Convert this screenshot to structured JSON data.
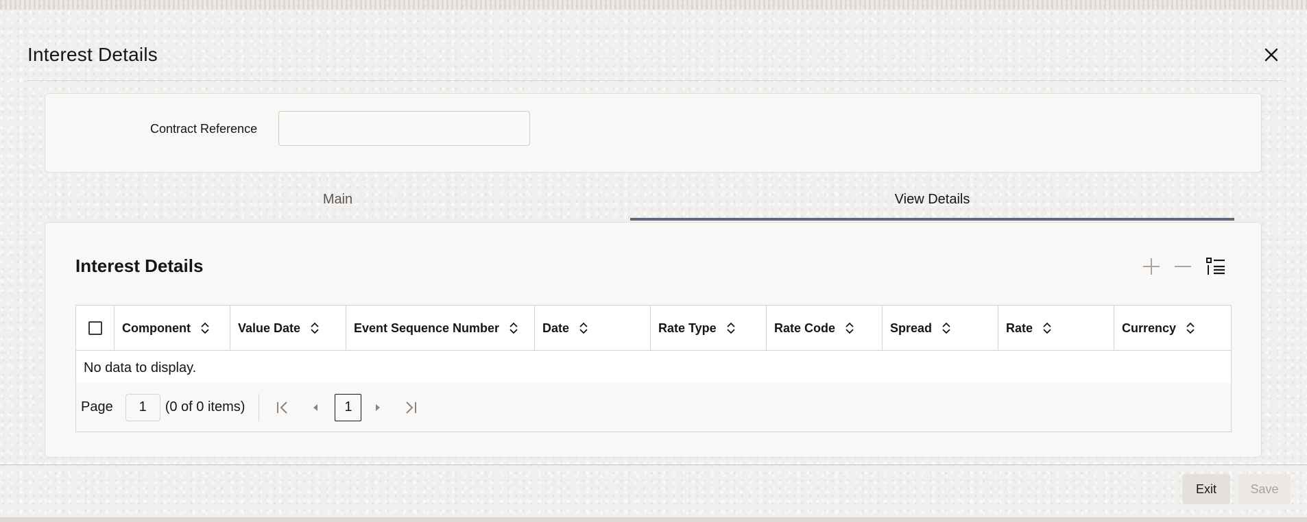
{
  "dialog": {
    "title": "Interest Details"
  },
  "header": {
    "contract_reference_label": "Contract Reference",
    "contract_reference_value": ""
  },
  "tabs": [
    {
      "label": "Main",
      "selected": false
    },
    {
      "label": "View Details",
      "selected": true
    }
  ],
  "section": {
    "title": "Interest Details",
    "icons": [
      "add-icon",
      "remove-icon",
      "list-view-icon"
    ]
  },
  "grid": {
    "columns": [
      "Component",
      "Value Date",
      "Event Sequence Number",
      "Date",
      "Rate Type",
      "Rate Code",
      "Spread",
      "Rate",
      "Currency"
    ],
    "empty_message": "No data to display."
  },
  "pager": {
    "page_label": "Page",
    "page_value": "1",
    "count_text": "(0 of 0 items)",
    "current_page": "1"
  },
  "footer": {
    "exit_label": "Exit",
    "save_label": "Save"
  },
  "colors": {
    "accent_tab_underline": "#5f6982",
    "text": "#161513",
    "muted": "#a9a4a0"
  }
}
